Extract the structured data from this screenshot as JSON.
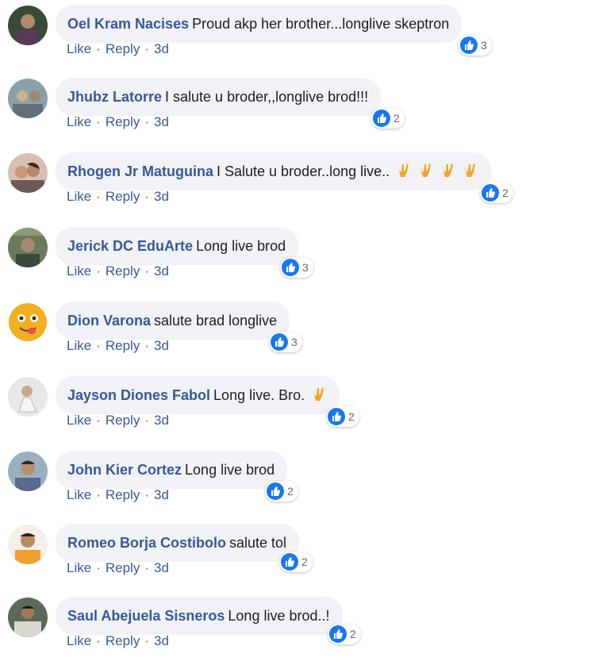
{
  "comments": [
    {
      "name": "Oel Kram Nacises",
      "text": "Proud akp her brother...longlive skeptron",
      "reactions": "3",
      "time": "3d",
      "emoji_count": 0
    },
    {
      "name": "Jhubz Latorre",
      "text": "I salute u broder,,longlive brod!!!",
      "reactions": "2",
      "time": "3d",
      "emoji_count": 0
    },
    {
      "name": "Rhogen Jr Matuguina",
      "text": "I Salute u broder..long live..",
      "reactions": "2",
      "time": "3d",
      "emoji_count": 4
    },
    {
      "name": "Jerick DC EduArte",
      "text": "Long live brod",
      "reactions": "3",
      "time": "3d",
      "emoji_count": 0
    },
    {
      "name": "Dion Varona",
      "text": "salute brad longlive",
      "reactions": "3",
      "time": "3d",
      "emoji_count": 0
    },
    {
      "name": "Jayson Diones Fabol",
      "text": "Long live. Bro.",
      "reactions": "2",
      "time": "3d",
      "emoji_count": 1
    },
    {
      "name": "John Kier Cortez",
      "text": "Long live brod",
      "reactions": "2",
      "time": "3d",
      "emoji_count": 0
    },
    {
      "name": "Romeo Borja Costibolo",
      "text": "salute tol",
      "reactions": "2",
      "time": "3d",
      "emoji_count": 0
    },
    {
      "name": "Saul Abejuela Sisneros",
      "text": "Long live brod..!",
      "reactions": "2",
      "time": "3d",
      "emoji_count": 0
    }
  ],
  "actions": {
    "like": "Like",
    "reply": "Reply",
    "separator": "·"
  },
  "icons": {
    "reaction": "like-thumb-icon",
    "emoji": "love-you-gesture-icon"
  },
  "colors": {
    "name": "#385898",
    "bubble": "#f0f2f5",
    "like_badge": "#1877f2",
    "meta": "#65676b"
  }
}
